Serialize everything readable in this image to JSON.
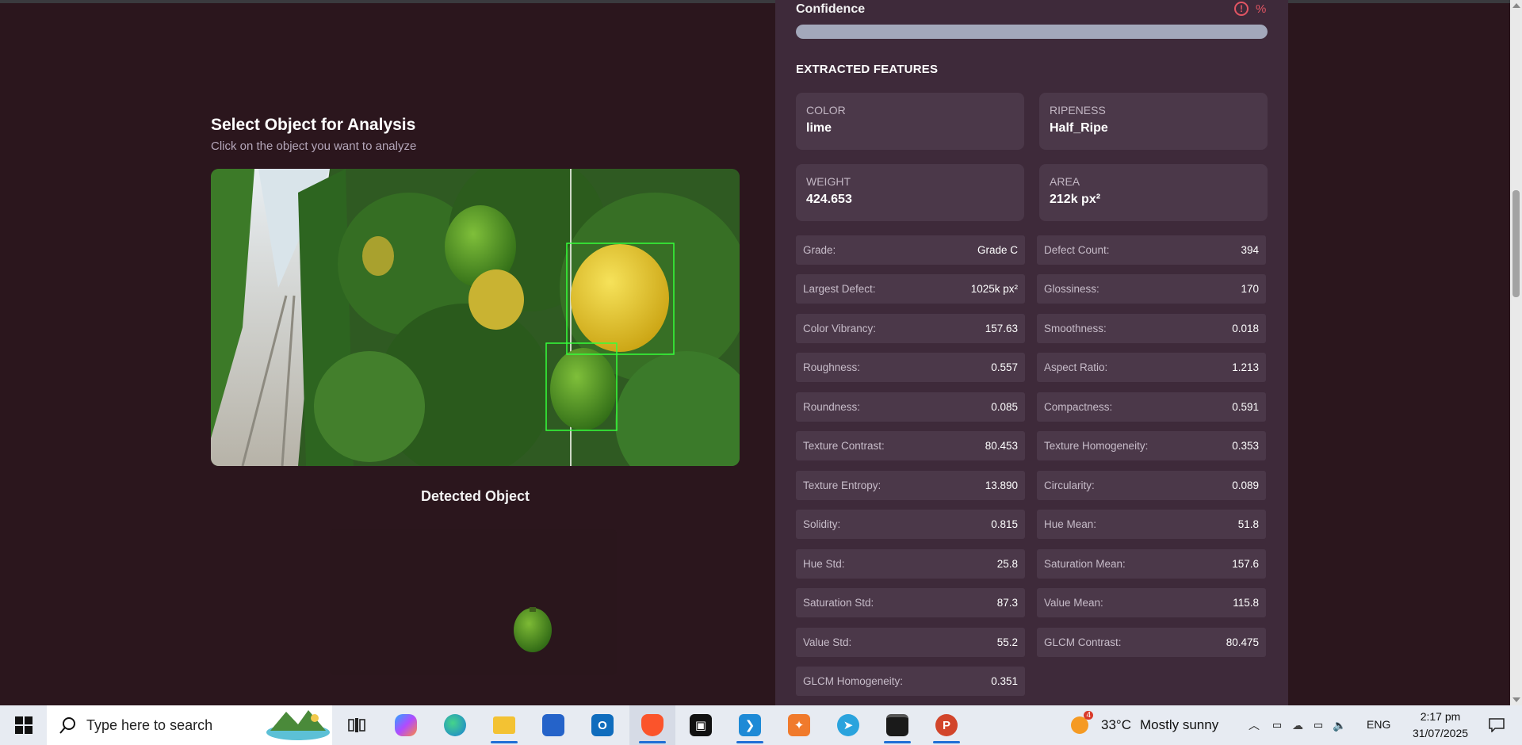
{
  "left": {
    "title": "Select Object for Analysis",
    "subtitle": "Click on the object you want to analyze",
    "detected_title": "Detected Object"
  },
  "confidence": {
    "label": "Confidence",
    "icon": "alert-circle-icon",
    "percent_text": "%",
    "fraction": 1.0
  },
  "features": {
    "title": "EXTRACTED FEATURES",
    "cards": [
      {
        "label": "COLOR",
        "value": "lime"
      },
      {
        "label": "RIPENESS",
        "value": "Half_Ripe"
      },
      {
        "label": "WEIGHT",
        "value": "424.653"
      },
      {
        "label": "AREA",
        "value": "212k px²"
      }
    ],
    "rows": [
      {
        "k": "Grade:",
        "v": "Grade C"
      },
      {
        "k": "Defect Count:",
        "v": "394"
      },
      {
        "k": "Largest Defect:",
        "v": "1025k px²"
      },
      {
        "k": "Glossiness:",
        "v": "170"
      },
      {
        "k": "Color Vibrancy:",
        "v": "157.63"
      },
      {
        "k": "Smoothness:",
        "v": "0.018"
      },
      {
        "k": "Roughness:",
        "v": "0.557"
      },
      {
        "k": "Aspect Ratio:",
        "v": "1.213"
      },
      {
        "k": "Roundness:",
        "v": "0.085"
      },
      {
        "k": "Compactness:",
        "v": "0.591"
      },
      {
        "k": "Texture Contrast:",
        "v": "80.453"
      },
      {
        "k": "Texture Homogeneity:",
        "v": "0.353"
      },
      {
        "k": "Texture Entropy:",
        "v": "13.890"
      },
      {
        "k": "Circularity:",
        "v": "0.089"
      },
      {
        "k": "Solidity:",
        "v": "0.815"
      },
      {
        "k": "Hue Mean:",
        "v": "51.8"
      },
      {
        "k": "Hue Std:",
        "v": "25.8"
      },
      {
        "k": "Saturation Mean:",
        "v": "157.6"
      },
      {
        "k": "Saturation Std:",
        "v": "87.3"
      },
      {
        "k": "Value Mean:",
        "v": "115.8"
      },
      {
        "k": "Value Std:",
        "v": "55.2"
      },
      {
        "k": "GLCM Contrast:",
        "v": "80.475"
      },
      {
        "k": "GLCM Homogeneity:",
        "v": "0.351"
      }
    ]
  },
  "taskbar": {
    "search_placeholder": "Type here to search",
    "weather_badge": "4",
    "temperature": "33°C",
    "weather": "Mostly sunny",
    "language": "ENG",
    "time": "2:17 pm",
    "date": "31/07/2025",
    "apps": [
      "task-view-icon",
      "copilot-icon",
      "edge-icon",
      "file-explorer-icon",
      "microsoft-store-icon",
      "outlook-icon",
      "brave-icon",
      "terminal-app-icon",
      "vscode-icon",
      "postman-icon",
      "telegram-icon",
      "cmd-icon",
      "powerpoint-icon"
    ]
  }
}
